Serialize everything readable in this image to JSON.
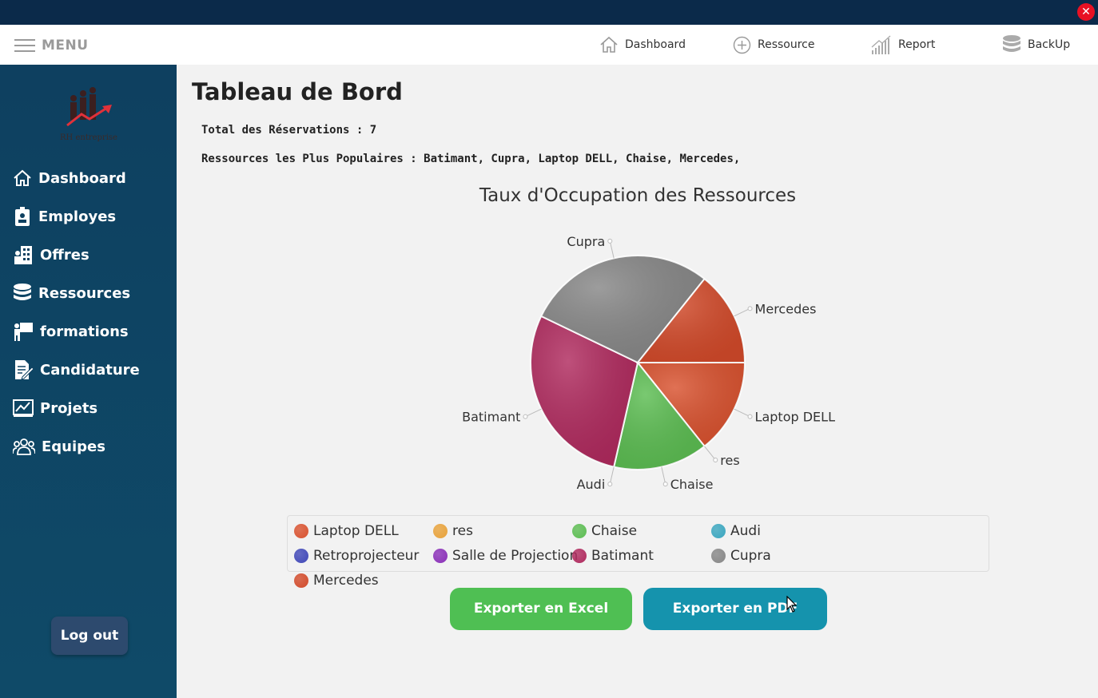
{
  "window": {
    "close_glyph": "✕"
  },
  "topbar": {
    "menu_label": "MENU",
    "nav": [
      {
        "label": "Dashboard",
        "icon": "home-icon"
      },
      {
        "label": "Ressource",
        "icon": "plus-circle-icon"
      },
      {
        "label": "Report",
        "icon": "signal-bars-icon"
      },
      {
        "label": "BackUp",
        "icon": "database-icon"
      }
    ]
  },
  "sidebar": {
    "logo_text": "RH entreprise",
    "items": [
      {
        "label": "Dashboard",
        "icon": "home-icon"
      },
      {
        "label": "Employes",
        "icon": "badge-icon"
      },
      {
        "label": "Offres",
        "icon": "building-icon"
      },
      {
        "label": "Ressources",
        "icon": "database-icon"
      },
      {
        "label": "formations",
        "icon": "presenter-icon"
      },
      {
        "label": "Candidature",
        "icon": "document-edit-icon"
      },
      {
        "label": "Projets",
        "icon": "chart-board-icon"
      },
      {
        "label": "Equipes",
        "icon": "team-icon"
      }
    ],
    "logout_label": "Log out"
  },
  "main": {
    "title": "Tableau de Bord",
    "total_reservations": "Total des Réservations : 7",
    "popular_resources": "Ressources les Plus Populaires : Batimant, Cupra, Laptop DELL, Chaise, Mercedes,",
    "export_excel": "Exporter en Excel",
    "export_pdf": "Exporter en PDF"
  },
  "chart_data": {
    "type": "pie",
    "title": "Taux d'Occupation des Ressources",
    "slices": [
      {
        "label": "Laptop DELL",
        "value": 14.3,
        "color": "#d9522f"
      },
      {
        "label": "res",
        "value": 0,
        "color": "#e8a23a"
      },
      {
        "label": "Chaise",
        "value": 14.3,
        "color": "#5cbd52"
      },
      {
        "label": "Audi",
        "value": 0,
        "color": "#3aa6bf"
      },
      {
        "label": "Retroprojecteur",
        "value": 0,
        "color": "#4048b8"
      },
      {
        "label": "Salle de Projection",
        "value": 0,
        "color": "#8a2fb8"
      },
      {
        "label": "Batimant",
        "value": 28.6,
        "color": "#b02a5e"
      },
      {
        "label": "Cupra",
        "value": 28.6,
        "color": "#878787"
      },
      {
        "label": "Mercedes",
        "value": 14.3,
        "color": "#d24a2a"
      }
    ],
    "legend": "bottom"
  }
}
